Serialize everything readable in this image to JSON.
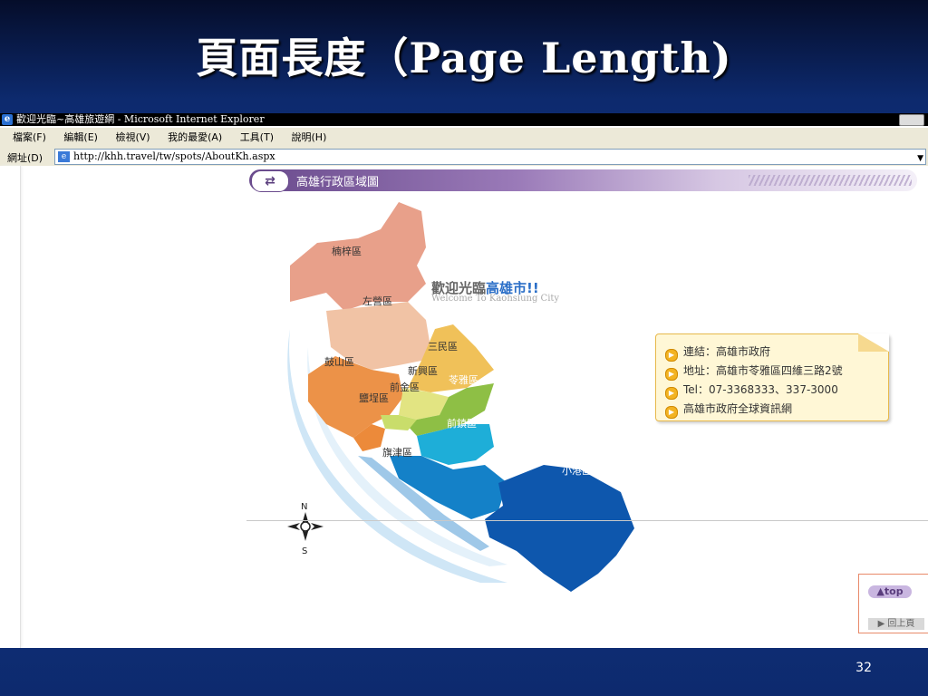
{
  "slide": {
    "title": "頁面長度（Page Length)",
    "page_number": "32"
  },
  "browser": {
    "window_title": "歡迎光臨~高雄旅遊網 - Microsoft Internet Explorer",
    "menu": [
      "檔案(F)",
      "編輯(E)",
      "檢視(V)",
      "我的最愛(A)",
      "工具(T)",
      "說明(H)"
    ],
    "address_label": "網址(D)",
    "url": "http://khh.travel/tw/spots/AboutKh.aspx"
  },
  "page": {
    "section_title": "高雄行政區域圖",
    "welcome_prefix": "歡迎光臨",
    "welcome_city": "高雄市!!",
    "welcome_en": "Welcome To Kaohsiung City",
    "districts": [
      "楠梓區",
      "左營區",
      "三民區",
      "鼓山區",
      "新興區",
      "苓雅區",
      "前金區",
      "鹽埕區",
      "前鎮區",
      "旗津區",
      "小港區"
    ],
    "compass_n": "N",
    "compass_s": "S",
    "info": [
      "連結：高雄市政府",
      "地址：高雄市苓雅區四維三路2號",
      "Tel：07-3368333、337-3000",
      "高雄市政府全球資訊網"
    ],
    "top_label": "▲top",
    "back_label": "▶ 回上頁"
  },
  "colors": {
    "header_purple": "#6a4b8d",
    "info_border": "#e8b94c",
    "slide_blue": "#123a8a"
  }
}
